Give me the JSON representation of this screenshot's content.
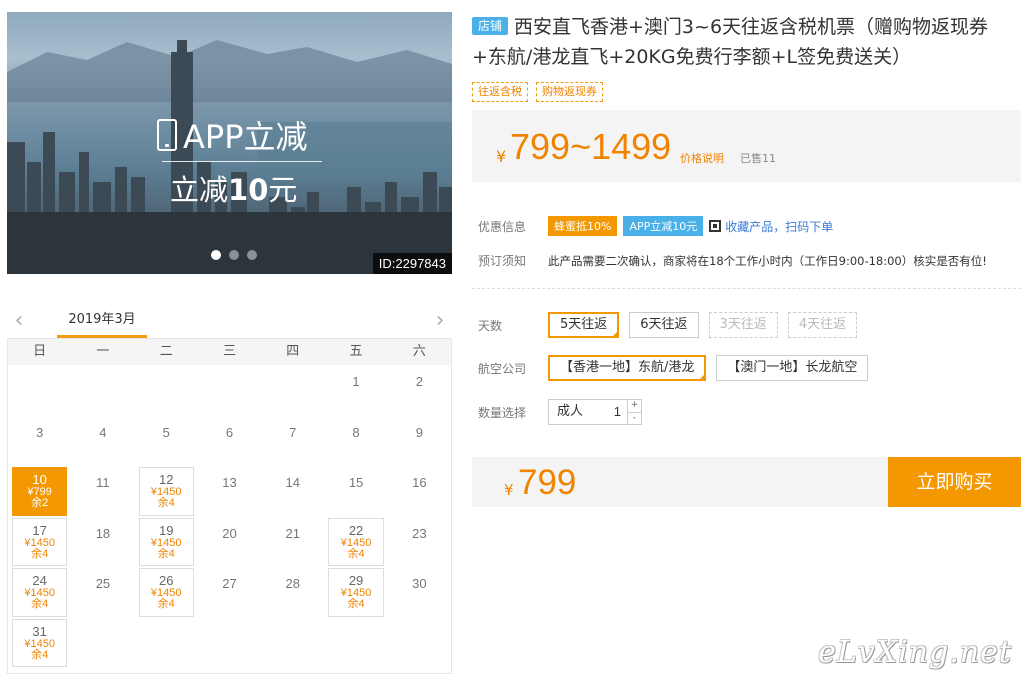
{
  "banner": {
    "app_title": "APP立减",
    "sub_prefix": "立减",
    "sub_amount": "10",
    "sub_suffix": "元",
    "id_tag": "ID:2297843",
    "slides": 3,
    "active_slide": 0
  },
  "calendar": {
    "month_label": "2019年3月",
    "weekdays": [
      "日",
      "一",
      "二",
      "三",
      "四",
      "五",
      "六"
    ],
    "weeks": [
      [
        null,
        null,
        null,
        null,
        null,
        {
          "day": "1"
        },
        {
          "day": "2"
        }
      ],
      [
        {
          "day": "3"
        },
        {
          "day": "4"
        },
        {
          "day": "5"
        },
        {
          "day": "6"
        },
        {
          "day": "7"
        },
        {
          "day": "8"
        },
        {
          "day": "9"
        }
      ],
      [
        {
          "day": "10",
          "price": "¥799",
          "stock": "余2",
          "selected": true
        },
        {
          "day": "11"
        },
        {
          "day": "12",
          "price": "¥1450",
          "stock": "余4"
        },
        {
          "day": "13"
        },
        {
          "day": "14"
        },
        {
          "day": "15"
        },
        {
          "day": "16"
        }
      ],
      [
        {
          "day": "17",
          "price": "¥1450",
          "stock": "余4"
        },
        {
          "day": "18"
        },
        {
          "day": "19",
          "price": "¥1450",
          "stock": "余4"
        },
        {
          "day": "20"
        },
        {
          "day": "21"
        },
        {
          "day": "22",
          "price": "¥1450",
          "stock": "余4"
        },
        {
          "day": "23"
        }
      ],
      [
        {
          "day": "24",
          "price": "¥1450",
          "stock": "余4"
        },
        {
          "day": "25"
        },
        {
          "day": "26",
          "price": "¥1450",
          "stock": "余4"
        },
        {
          "day": "27"
        },
        {
          "day": "28"
        },
        {
          "day": "29",
          "price": "¥1450",
          "stock": "余4"
        },
        {
          "day": "30"
        }
      ],
      [
        {
          "day": "31",
          "price": "¥1450",
          "stock": "余4"
        },
        null,
        null,
        null,
        null,
        null,
        null
      ]
    ]
  },
  "product": {
    "shop_badge": "店铺",
    "title": "西安直飞香港+澳门3~6天往返含税机票（赠购物返现券+东航/港龙直飞+20KG免费行李额+L签免费送关）",
    "tags": [
      "往返含税",
      "购物返现券"
    ],
    "price_symbol": "¥",
    "price_range": "799~1499",
    "price_explain": "价格说明",
    "sold": "已售11",
    "offer_label": "优惠信息",
    "offer_badge_1": "蜂蜜抵10%",
    "offer_badge_2": "APP立减10元",
    "collect_link": "收藏产品，扫码下单",
    "notice_label": "预订须知",
    "notice_text": "此产品需要二次确认，商家将在18个工作小时内（工作日9:00-18:00）核实是否有位!"
  },
  "options": {
    "days_label": "天数",
    "days": [
      {
        "label": "5天往返",
        "state": "selected"
      },
      {
        "label": "6天往返",
        "state": "normal"
      },
      {
        "label": "3天往返",
        "state": "disabled"
      },
      {
        "label": "4天往返",
        "state": "disabled"
      }
    ],
    "airline_label": "航空公司",
    "airlines": [
      {
        "label": "【香港一地】东航/港龙",
        "state": "selected"
      },
      {
        "label": "【澳门一地】长龙航空",
        "state": "normal"
      }
    ],
    "qty_label": "数量选择",
    "qty_type": "成人",
    "qty_value": "1",
    "qty_plus": "+",
    "qty_minus": "-"
  },
  "buy": {
    "price_symbol": "¥",
    "amount": "799",
    "button_label": "立即购买"
  },
  "watermark": "eLvXing.net"
}
